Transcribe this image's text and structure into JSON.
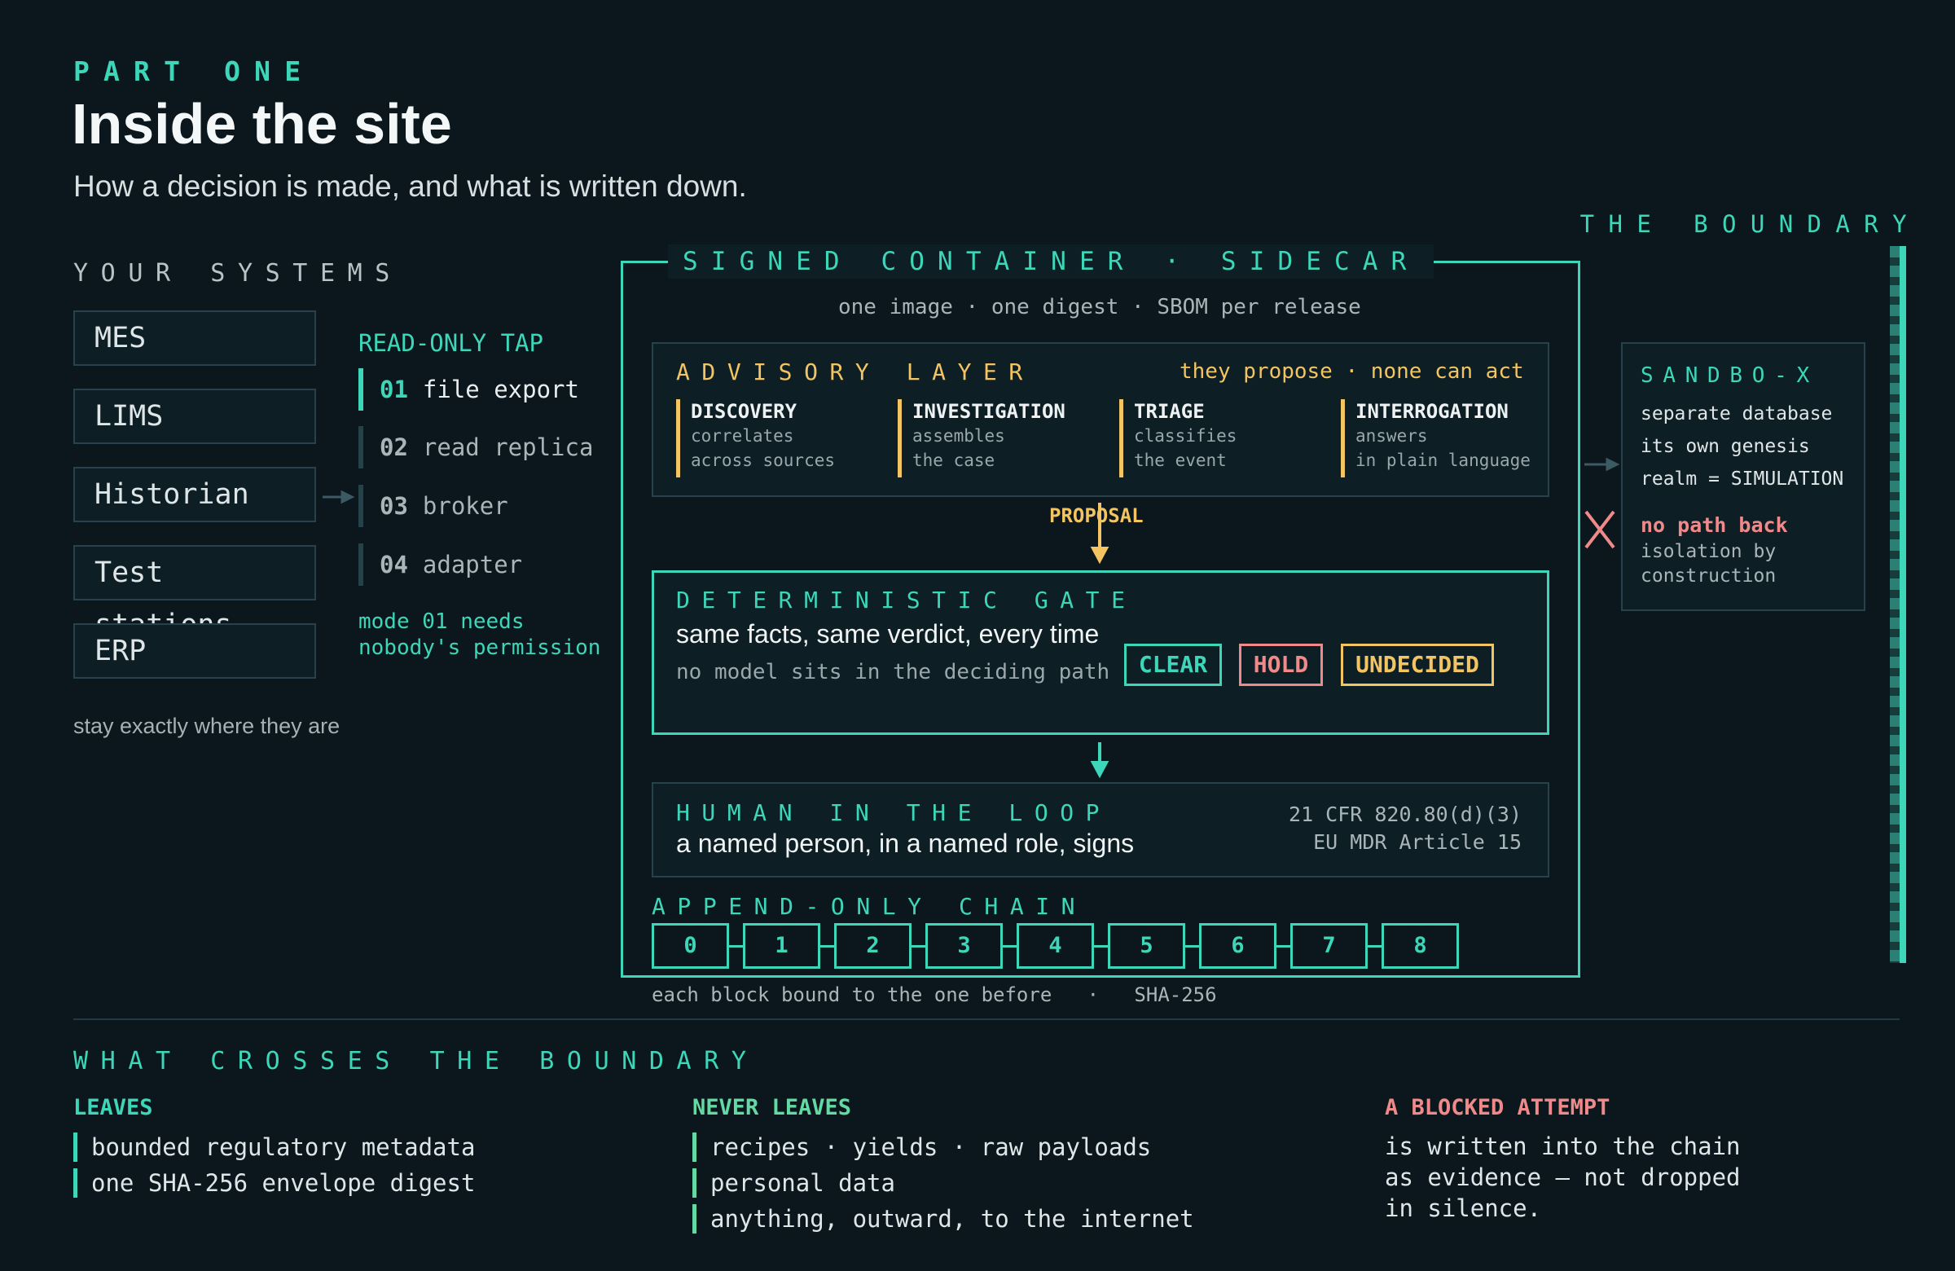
{
  "header": {
    "eyebrow": "PART  ONE",
    "title": "Inside the site",
    "subtitle": "How a decision is made, and what is written down."
  },
  "systems": {
    "heading": "YOUR  SYSTEMS",
    "items": [
      "MES",
      "LIMS",
      "Historian",
      "Test stations",
      "ERP"
    ],
    "footnote": "stay exactly where they are"
  },
  "tap": {
    "heading": "READ-ONLY TAP",
    "items": [
      {
        "num": "01",
        "label": "file export"
      },
      {
        "num": "02",
        "label": "read replica"
      },
      {
        "num": "03",
        "label": "broker"
      },
      {
        "num": "04",
        "label": "adapter"
      }
    ],
    "note_line1": "mode 01 needs",
    "note_line2": "nobody's permission"
  },
  "container": {
    "title": "SIGNED  CONTAINER  ·  SIDECAR",
    "subtitle": "one image · one digest · SBOM per release",
    "advisory": {
      "title": "ADVISORY  LAYER",
      "tagline": "they propose · none can act",
      "columns": [
        {
          "name": "DISCOVERY",
          "line1": "correlates",
          "line2": "across sources"
        },
        {
          "name": "INVESTIGATION",
          "line1": "assembles",
          "line2": "the case"
        },
        {
          "name": "TRIAGE",
          "line1": "classifies",
          "line2": "the event"
        },
        {
          "name": "INTERROGATION",
          "line1": "answers",
          "line2": "in plain language"
        }
      ]
    },
    "proposal_label": "PROPOSAL",
    "gate": {
      "title": "DETERMINISTIC  GATE",
      "statement": "same facts, same verdict, every time",
      "note": "no model sits in the deciding path",
      "verdicts": [
        "CLEAR",
        "HOLD",
        "UNDECIDED"
      ]
    },
    "human": {
      "title": "HUMAN  IN  THE  LOOP",
      "statement": "a named person, in a named role, signs",
      "ref1": "21 CFR 820.80(d)(3)",
      "ref2": "EU MDR Article 15"
    },
    "chain": {
      "title": "APPEND-ONLY  CHAIN",
      "blocks": [
        "0",
        "1",
        "2",
        "3",
        "4",
        "5",
        "6",
        "7",
        "8"
      ],
      "caption": "each block bound to the one before   ·   SHA-256"
    }
  },
  "boundary": {
    "label": "THE  BOUNDARY"
  },
  "sandbox": {
    "title": "SANDBO-X",
    "line1": "separate database",
    "line2": "its own genesis",
    "line3": "realm = SIMULATION",
    "no_path": "no path back",
    "iso1": "isolation by",
    "iso2": "construction"
  },
  "crosses": {
    "heading": "WHAT  CROSSES  THE  BOUNDARY",
    "leaves": {
      "title": "LEAVES",
      "items": [
        "bounded regulatory metadata",
        "one SHA-256 envelope digest"
      ]
    },
    "never": {
      "title": "NEVER LEAVES",
      "items": [
        "recipes · yields · raw payloads",
        "personal data",
        "anything, outward, to the internet"
      ]
    },
    "blocked": {
      "title": "A BLOCKED ATTEMPT",
      "line1": "is written into the chain",
      "line2": "as evidence — not dropped",
      "line3": "in silence."
    }
  },
  "colors": {
    "background": "#0b171d",
    "teal": "#3dd6b9",
    "amber": "#f2c462",
    "red": "#f08a8a",
    "green": "#63d9a3"
  }
}
